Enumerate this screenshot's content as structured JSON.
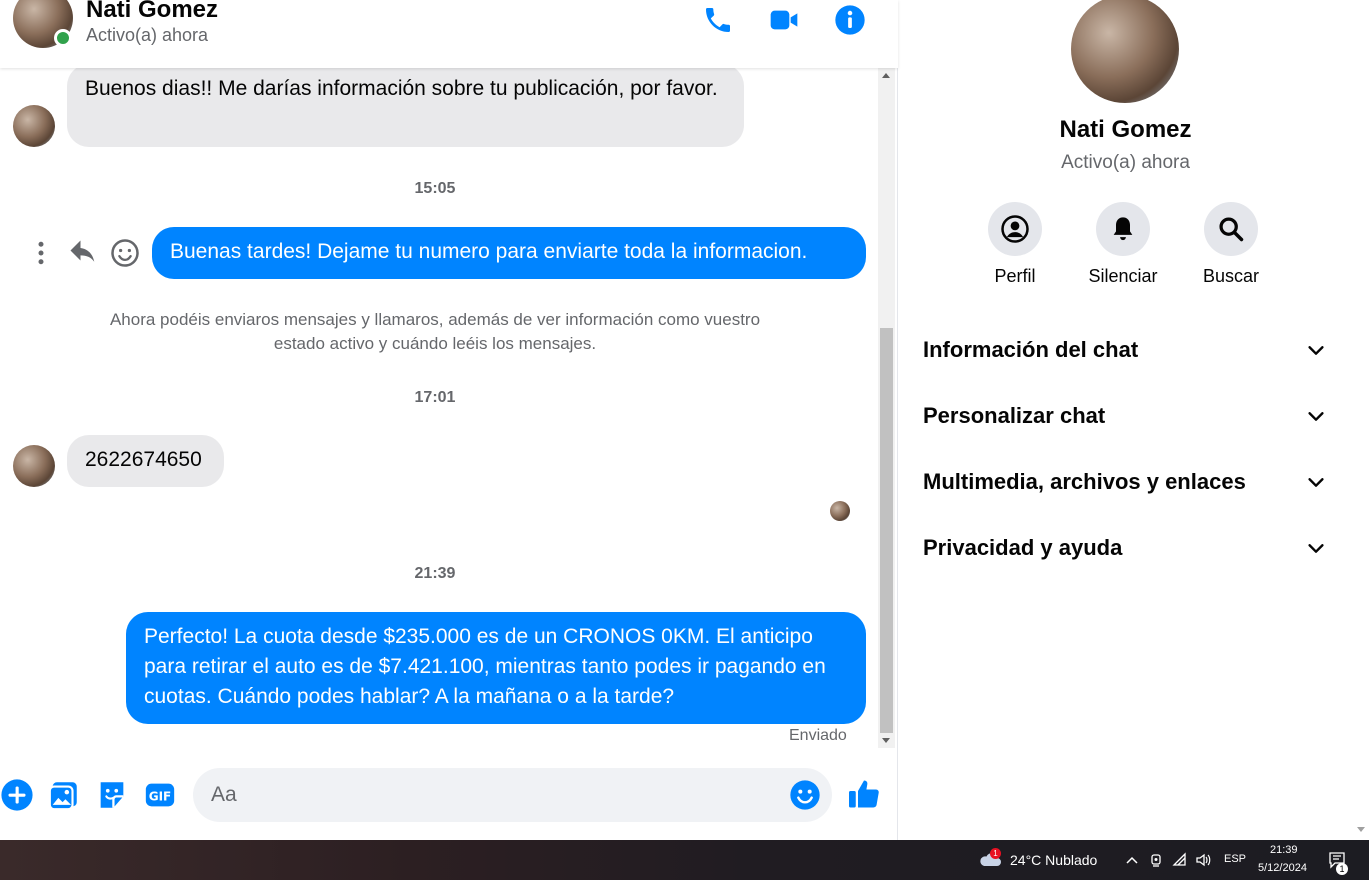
{
  "header": {
    "name": "Nati Gomez",
    "status": "Activo(a) ahora"
  },
  "messages": {
    "m1_text": "Buenos dias!! Me darías información sobre tu publicación, por favor.",
    "t1": "15:05",
    "m2_text": "Buenas tardes! Dejame tu numero para enviarte toda la informacion.",
    "system_note": "Ahora podéis enviaros mensajes y llamaros, además de ver información como vuestro estado activo y cuándo leéis los mensajes.",
    "t2": "17:01",
    "m3_text": "2622674650",
    "t3": "21:39",
    "m4_text": "Perfecto! La cuota desde $235.000 es de un CRONOS 0KM. El anticipo para retirar el auto es de $7.421.100, mientras tanto podes ir pagando en cuotas. Cuándo podes hablar? A la mañana o a la tarde?",
    "sent_label": "Enviado"
  },
  "composer": {
    "placeholder": "Aa"
  },
  "panel": {
    "name": "Nati Gomez",
    "status": "Activo(a) ahora",
    "actions": [
      {
        "label": "Perfil",
        "icon": "profile-icon"
      },
      {
        "label": "Silenciar",
        "icon": "bell-icon"
      },
      {
        "label": "Buscar",
        "icon": "search-icon"
      }
    ],
    "sections": [
      {
        "label": "Información del chat"
      },
      {
        "label": "Personalizar chat"
      },
      {
        "label": "Multimedia, archivos y enlaces"
      },
      {
        "label": "Privacidad y ayuda"
      }
    ]
  },
  "taskbar": {
    "weather_badge": "1",
    "weather": "24°C  Nublado",
    "lang": "ESP",
    "time": "21:39",
    "date": "5/12/2024",
    "notif_count": "1"
  },
  "colors": {
    "accent": "#0084ff",
    "online": "#31a24c",
    "incoming_bubble": "#e9e9eb"
  }
}
